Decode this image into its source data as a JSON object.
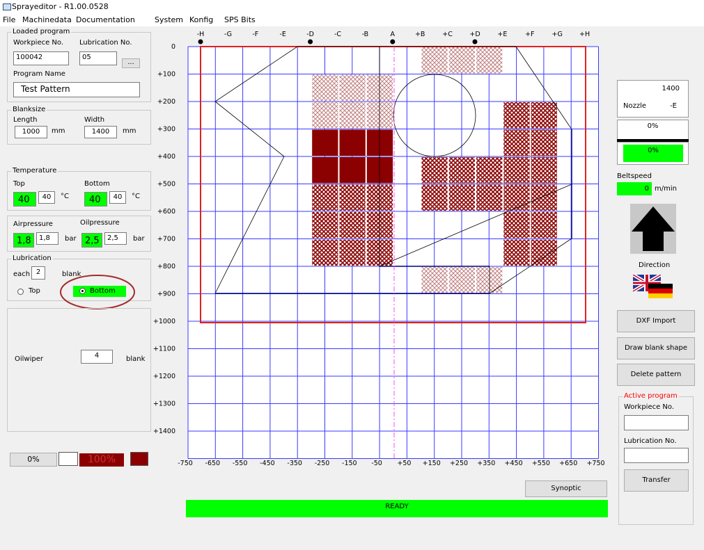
{
  "window": {
    "title": "Sprayeditor - R1.00.0528"
  },
  "menu": [
    "File",
    "Machinedata",
    "Documentation",
    "System",
    "Konfig",
    "SPS Bits"
  ],
  "loaded_program": {
    "legend": "Loaded program",
    "workpiece_label": "Workpiece No.",
    "workpiece_value": "100042",
    "lubrication_label": "Lubrication No.",
    "lubrication_value": "05",
    "browse_label": "...",
    "program_name_label": "Program Name",
    "program_name_value": "Test Pattern"
  },
  "blanksize": {
    "legend": "Blanksize",
    "length_label": "Length",
    "length_value": "1000",
    "length_unit": "mm",
    "width_label": "Width",
    "width_value": "1400",
    "width_unit": "mm"
  },
  "temperature": {
    "legend": "Temperature",
    "top_label": "Top",
    "top_actual": "40",
    "top_set": "40",
    "top_unit": "°C",
    "bottom_label": "Bottom",
    "bottom_actual": "40",
    "bottom_set": "40",
    "bottom_unit": "°C"
  },
  "pressure": {
    "air_label": "Airpressure",
    "air_actual": "1,8",
    "air_set": "1,8",
    "air_unit": "bar",
    "oil_label": "Oilpressure",
    "oil_actual": "2,5",
    "oil_set": "2,5",
    "oil_unit": "bar"
  },
  "lubrication": {
    "legend": "Lubrication",
    "each_label": "each",
    "each_value": "2",
    "blank_label": "blank",
    "top_option": "Top",
    "bottom_option": "Bottom",
    "selected": "Bottom"
  },
  "oilwiper": {
    "label": "Oilwiper",
    "value": "4",
    "unit": "blank"
  },
  "bottom_left": {
    "progress_label": "0%",
    "progress_right_label": "100%"
  },
  "grid": {
    "top_labels": [
      "-H",
      "-G",
      "-F",
      "-E",
      "-D",
      "-C",
      "-B",
      "A",
      "+B",
      "+C",
      "+D",
      "+E",
      "+F",
      "+G",
      "+H"
    ],
    "top_dots": [
      "-H",
      "-D",
      "A",
      "+D"
    ],
    "y_labels": [
      "0",
      "+100",
      "+200",
      "+300",
      "+400",
      "+500",
      "+600",
      "+700",
      "+800",
      "+900",
      "+1000",
      "+1100",
      "+1200",
      "+1300",
      "+1400"
    ],
    "x_labels": [
      "-750",
      "-650",
      "-550",
      "-450",
      "-350",
      "-250",
      "-150",
      "-50",
      "+50",
      "+150",
      "+250",
      "+350",
      "+450",
      "+550",
      "+650",
      "+750"
    ],
    "colors": {
      "grid": "#3a3aff",
      "blank": "#e02020",
      "solid": "#8b0000",
      "hatch": "#8b0000",
      "centerline": "#ff44ff"
    }
  },
  "right_panel": {
    "nozzle_value": "1400",
    "nozzle_label": "Nozzle",
    "nozzle_id": "-E",
    "progress_top": "0%",
    "progress_bottom": "0%",
    "beltspeed_label": "Beltspeed",
    "beltspeed_value": "0",
    "beltspeed_unit": "m/min",
    "direction_label": "Direction",
    "dxf_button": "DXF Import",
    "draw_button": "Draw blank shape",
    "delete_button": "Delete pattern",
    "active_legend": "Active program",
    "active_workpiece_label": "Workpiece No.",
    "active_lubrication_label": "Lubrication No.",
    "transfer_button": "Transfer"
  },
  "synoptic_button": "Synoptic",
  "status": {
    "text": "READY"
  }
}
